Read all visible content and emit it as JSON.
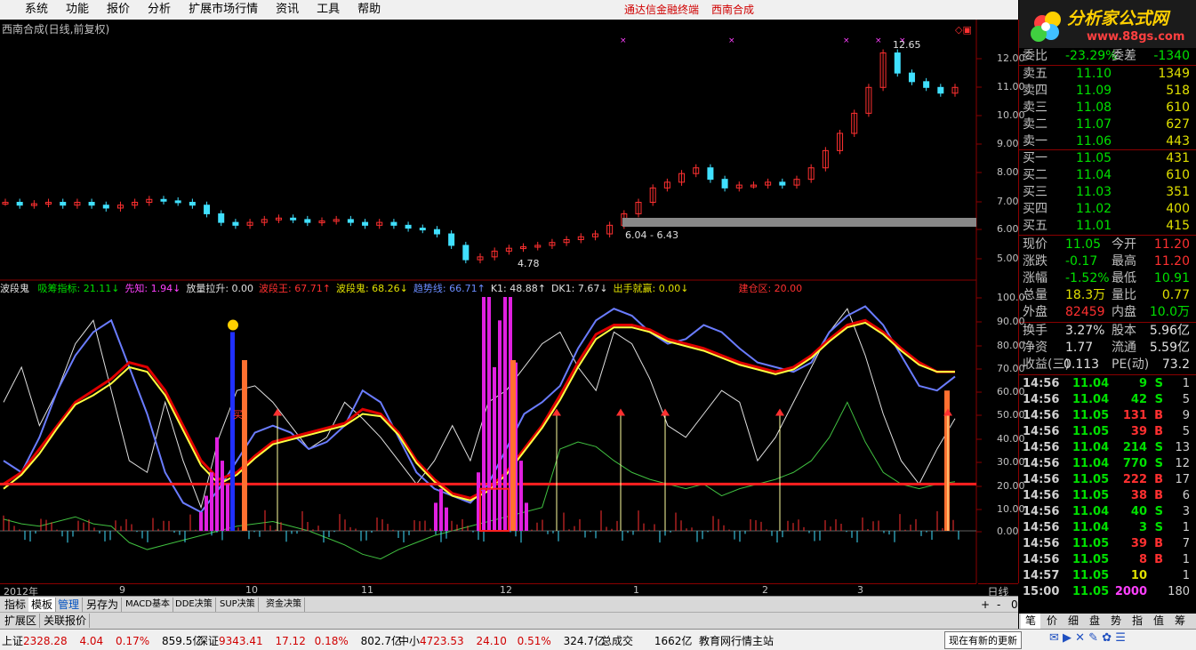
{
  "menu": {
    "items": [
      "系统",
      "功能",
      "报价",
      "分析",
      "扩展市场行情",
      "资讯",
      "工具",
      "帮助"
    ],
    "center_title": "通达信金融终端",
    "center_stock": "西南合成"
  },
  "logo": {
    "text": "分析家公式网",
    "url": "www.88gs.com"
  },
  "chart": {
    "title": "西南合成(日线,前复权)",
    "price_axis": [
      "12.00",
      "11.00",
      "10.00",
      "9.00",
      "8.00",
      "7.00",
      "6.00",
      "5.00"
    ],
    "high_label": "12.65",
    "low_label": "4.78",
    "range_label": "6.04 - 6.43",
    "indicator_axis": [
      "100.0",
      "90.00",
      "80.00",
      "70.00",
      "60.00",
      "50.00",
      "40.00",
      "30.00",
      "20.00",
      "10.00",
      "0.00"
    ]
  },
  "indicator": {
    "name": "波段鬼",
    "items": [
      {
        "label": "吸筹指标: 21.11↓",
        "color": "#00e000"
      },
      {
        "label": "先知: 1.94↓",
        "color": "#ff40ff"
      },
      {
        "label": "放量拉升: 0.00",
        "color": "#e0e0e0"
      },
      {
        "label": "波段王: 67.71↑",
        "color": "#ff3030"
      },
      {
        "label": "波段鬼: 68.26↓",
        "color": "#e0e000"
      },
      {
        "label": "趋势线: 66.71↑",
        "color": "#6a8cff"
      },
      {
        "label": "K1: 48.88↑",
        "color": "#e0e0e0"
      },
      {
        "label": "DK1: 7.67↓",
        "color": "#e0e0e0"
      },
      {
        "label": "出手就赢: 0.00↓",
        "color": "#e0e000"
      },
      {
        "label": "建仓区: 20.00",
        "color": "#ff3030"
      }
    ],
    "buy_marker": "买"
  },
  "date_axis": {
    "labels": [
      "2012年",
      "9",
      "10",
      "11",
      "12",
      "1",
      "2",
      "3"
    ],
    "period": "日线"
  },
  "tabs": {
    "row1": [
      "指标",
      "模板",
      "管理",
      "另存为",
      "MACD基本",
      "DDE决策",
      "SUP决策",
      "资金决策"
    ],
    "row2": [
      "扩展区",
      "关联报价"
    ],
    "zoom": [
      "+",
      "-",
      "0"
    ]
  },
  "quote": {
    "webi": {
      "label": "委比",
      "value": "-23.29%",
      "label2": "委差",
      "value2": "-1340"
    },
    "asks": [
      {
        "label": "卖五",
        "price": "11.10",
        "vol": "1349"
      },
      {
        "label": "卖四",
        "price": "11.09",
        "vol": "518"
      },
      {
        "label": "卖三",
        "price": "11.08",
        "vol": "610"
      },
      {
        "label": "卖二",
        "price": "11.07",
        "vol": "627"
      },
      {
        "label": "卖一",
        "price": "11.06",
        "vol": "443"
      }
    ],
    "bids": [
      {
        "label": "买一",
        "price": "11.05",
        "vol": "431"
      },
      {
        "label": "买二",
        "price": "11.04",
        "vol": "610"
      },
      {
        "label": "买三",
        "price": "11.03",
        "vol": "351"
      },
      {
        "label": "买四",
        "price": "11.02",
        "vol": "400"
      },
      {
        "label": "买五",
        "price": "11.01",
        "vol": "415"
      }
    ],
    "stats": [
      {
        "l1": "现价",
        "v1": "11.05",
        "c1": "#00e000",
        "l2": "今开",
        "v2": "11.20",
        "c2": "#ff3030"
      },
      {
        "l1": "涨跌",
        "v1": "-0.17",
        "c1": "#00e000",
        "l2": "最高",
        "v2": "11.20",
        "c2": "#ff3030"
      },
      {
        "l1": "涨幅",
        "v1": "-1.52%",
        "c1": "#00e000",
        "l2": "最低",
        "v2": "10.91",
        "c2": "#00e000"
      },
      {
        "l1": "总量",
        "v1": "18.3万",
        "c1": "#e0e000",
        "l2": "量比",
        "v2": "0.77",
        "c2": "#e0e000"
      },
      {
        "l1": "外盘",
        "v1": "82459",
        "c1": "#ff3030",
        "l2": "内盘",
        "v2": "10.0万",
        "c2": "#00e000"
      },
      {
        "l1": "换手",
        "v1": "3.27%",
        "c1": "#e0e0e0",
        "l2": "股本",
        "v2": "5.96亿",
        "c2": "#e0e0e0"
      },
      {
        "l1": "净资",
        "v1": "1.77",
        "c1": "#e0e0e0",
        "l2": "流通",
        "v2": "5.59亿",
        "c2": "#e0e0e0"
      },
      {
        "l1": "收益(三)",
        "v1": "0.113",
        "c1": "#e0e0e0",
        "l2": "PE(动)",
        "v2": "73.2",
        "c2": "#e0e0e0"
      }
    ],
    "ticks": [
      {
        "t": "14:56",
        "p": "11.04",
        "v": "9",
        "d": "S",
        "n": "1"
      },
      {
        "t": "14:56",
        "p": "11.04",
        "v": "42",
        "d": "S",
        "n": "5"
      },
      {
        "t": "14:56",
        "p": "11.05",
        "v": "131",
        "d": "B",
        "n": "9"
      },
      {
        "t": "14:56",
        "p": "11.05",
        "v": "39",
        "d": "B",
        "n": "5"
      },
      {
        "t": "14:56",
        "p": "11.04",
        "v": "214",
        "d": "S",
        "n": "13"
      },
      {
        "t": "14:56",
        "p": "11.04",
        "v": "770",
        "d": "S",
        "n": "12"
      },
      {
        "t": "14:56",
        "p": "11.05",
        "v": "222",
        "d": "B",
        "n": "17"
      },
      {
        "t": "14:56",
        "p": "11.05",
        "v": "38",
        "d": "B",
        "n": "6"
      },
      {
        "t": "14:56",
        "p": "11.04",
        "v": "40",
        "d": "S",
        "n": "3"
      },
      {
        "t": "14:56",
        "p": "11.04",
        "v": "3",
        "d": "S",
        "n": "1"
      },
      {
        "t": "14:56",
        "p": "11.05",
        "v": "39",
        "d": "B",
        "n": "7"
      },
      {
        "t": "14:56",
        "p": "11.05",
        "v": "8",
        "d": "B",
        "n": "1"
      },
      {
        "t": "14:57",
        "p": "11.05",
        "v": "10",
        "d": "",
        "n": "1"
      },
      {
        "t": "15:00",
        "p": "11.05",
        "v": "2000",
        "d": "",
        "n": "180"
      }
    ],
    "tabs": [
      "笔",
      "价",
      "细",
      "盘",
      "势",
      "指",
      "值",
      "筹"
    ]
  },
  "status": {
    "sh": {
      "name": "上证",
      "value": "2328.28",
      "chg": "4.04",
      "pct": "0.17%",
      "amt": "859.5亿"
    },
    "sz": {
      "name": "深证",
      "value": "9343.41",
      "chg": "17.12",
      "pct": "0.18%",
      "amt": "802.7亿"
    },
    "zx": {
      "name": "中小",
      "value": "4723.53",
      "chg": "24.10",
      "pct": "0.51%",
      "amt": "324.7亿"
    },
    "total": {
      "name": "总成交",
      "amt": "1662亿"
    },
    "news": "教育网行情主站",
    "popup": "现在有新的更新"
  },
  "colors": {
    "up": "#ff3030",
    "down": "#40e0ff",
    "grid": "#8a0000",
    "brand": "#d00000"
  }
}
